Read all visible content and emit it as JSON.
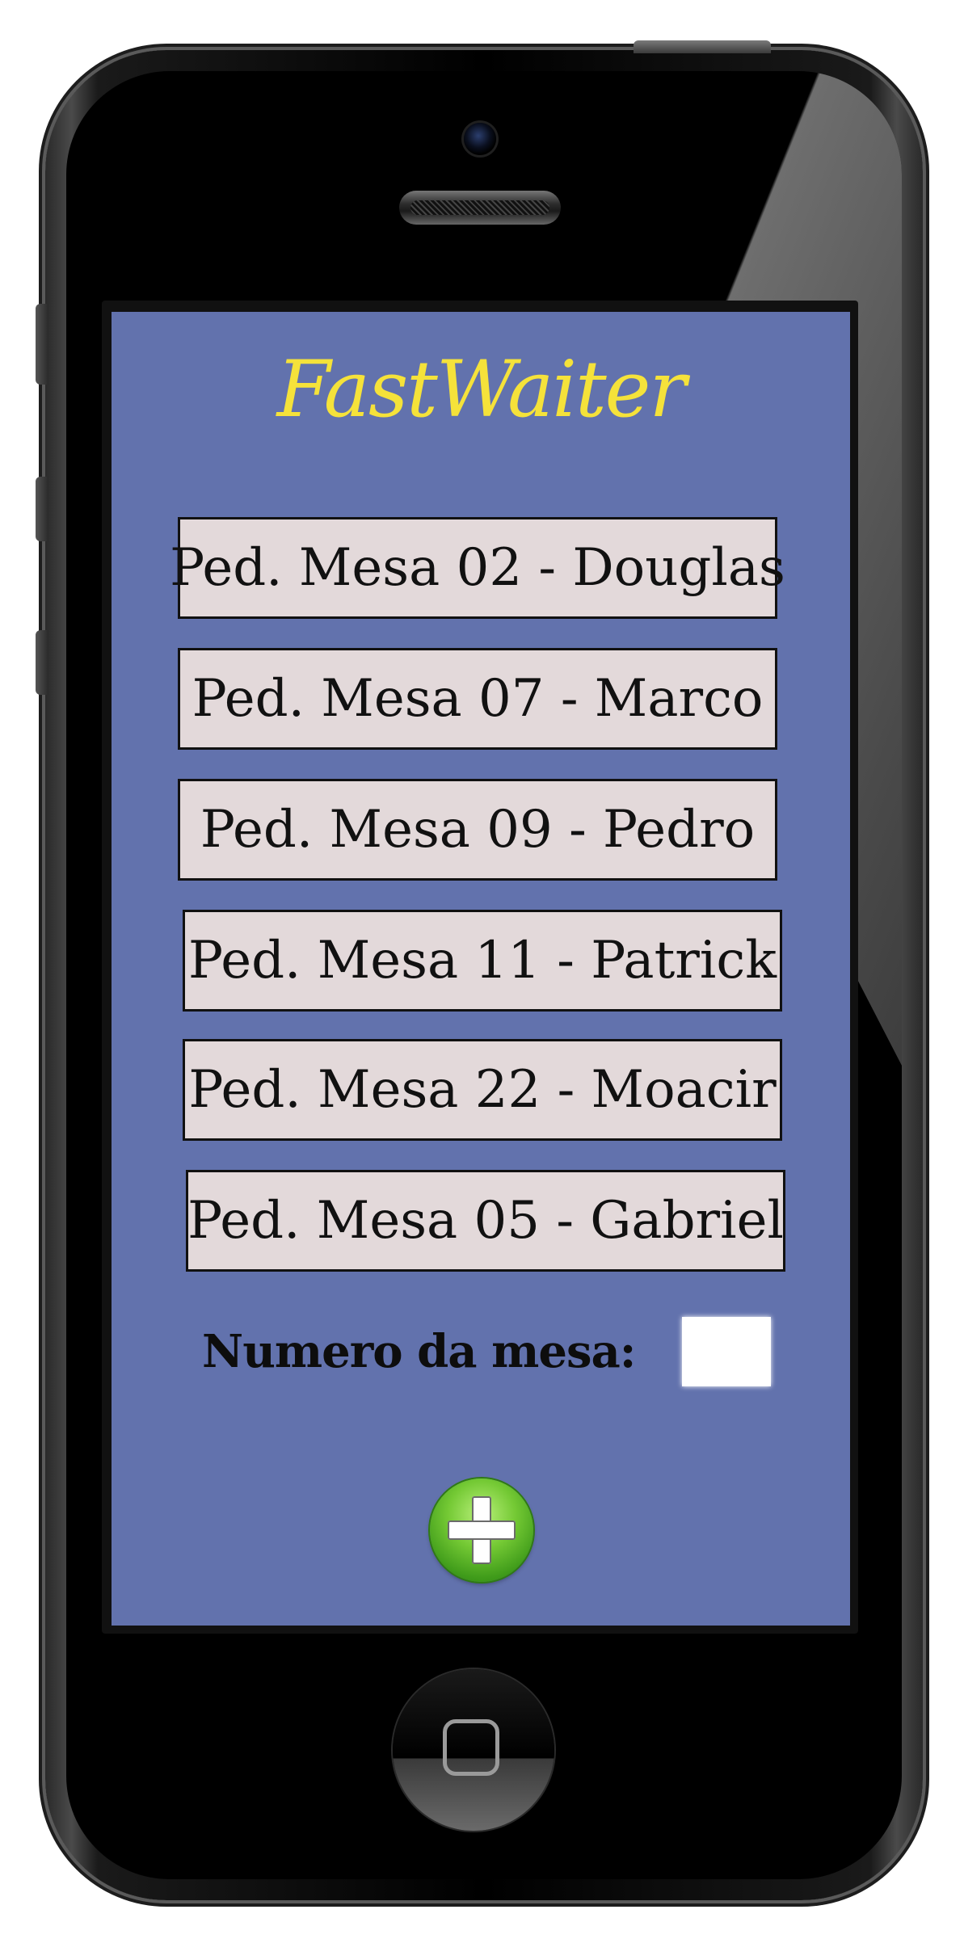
{
  "app": {
    "title": "FastWaiter"
  },
  "orders": [
    {
      "label": "Ped. Mesa 02 - Douglas"
    },
    {
      "label": "Ped. Mesa 07 - Marco"
    },
    {
      "label": "Ped. Mesa 09 - Pedro"
    },
    {
      "label": "Ped. Mesa 11 - Patrick"
    },
    {
      "label": "Ped. Mesa 22 - Moacir"
    },
    {
      "label": "Ped. Mesa 05 - Gabriel"
    }
  ],
  "table_form": {
    "label": "Numero da mesa:",
    "value": ""
  },
  "icons": {
    "add": "plus-circle-icon",
    "home": "home-button-icon"
  },
  "colors": {
    "screen_background": "#6272ad",
    "title": "#f5e23a",
    "order_button": "#e3d9da",
    "add_button": "#74c934"
  }
}
